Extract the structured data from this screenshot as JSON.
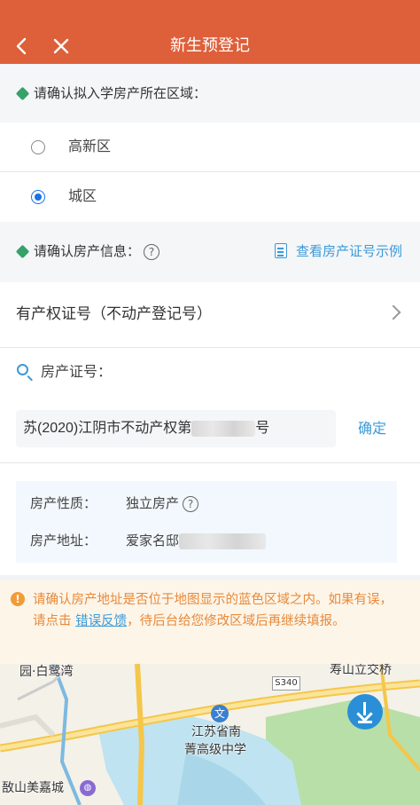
{
  "header": {
    "title": "新生预登记",
    "back_icon": "arrow-left-icon",
    "close_icon": "close-icon"
  },
  "region_section": {
    "title": "请确认拟入学房产所在区域：",
    "options": [
      {
        "label": "高新区",
        "selected": false
      },
      {
        "label": "城区",
        "selected": true
      }
    ]
  },
  "property_section": {
    "title": "请确认房产信息：",
    "help": "?",
    "sample_link": "查看房产证号示例"
  },
  "certificate": {
    "type_label": "有产权证号（不动产登记号）",
    "search_label": "房产证号：",
    "value_prefix": "苏(2020)江阴市不动产权第",
    "value_suffix": "号",
    "confirm_label": "确定"
  },
  "property_info": {
    "nature_label": "房产性质：",
    "nature_value": "独立房产",
    "address_label": "房产地址：",
    "address_value": "爱家名邸"
  },
  "warning": {
    "text_before": "请确认房产地址是否位于地图显示的蓝色区域之内。如果有误，请点击",
    "link": "错误反馈",
    "text_after": "，待后台给您修改区域后再继续填报。"
  },
  "map": {
    "labels": {
      "yuanbai": "园·白鹭湾",
      "shoushan": "寿山立交桥",
      "route": "S340",
      "school_line1": "江苏省南",
      "school_line2": "菁高级中学",
      "mall": "敔山美嘉城"
    },
    "school_glyph": "文",
    "shop_glyph": "◍"
  },
  "colors": {
    "header": "#dd603a",
    "accent": "#3a9ad9",
    "radio_selected": "#1a73e8",
    "section_dot": "#35a26a",
    "warning_text": "#e8893a",
    "warning_bg": "#fdf5e8",
    "map_water": "#bfe3f0",
    "map_green": "#b8dfa8"
  }
}
